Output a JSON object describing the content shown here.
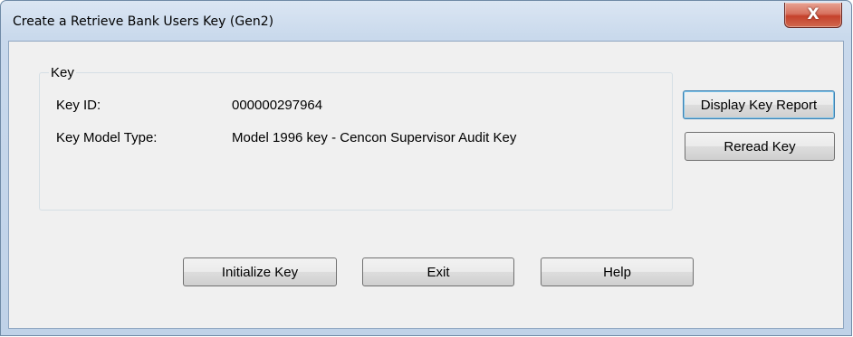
{
  "window": {
    "title": "Create a Retrieve Bank Users Key (Gen2)",
    "close_glyph": "X"
  },
  "key_group": {
    "label": "Key",
    "key_id_label": "Key ID:",
    "key_id_value": "000000297964",
    "model_type_label": "Key Model Type:",
    "model_type_value": "Model 1996 key - Cencon Supervisor Audit Key"
  },
  "side_buttons": {
    "display_report": "Display Key Report",
    "reread": "Reread Key"
  },
  "bottom_buttons": {
    "initialize": "Initialize Key",
    "exit": "Exit",
    "help": "Help"
  }
}
